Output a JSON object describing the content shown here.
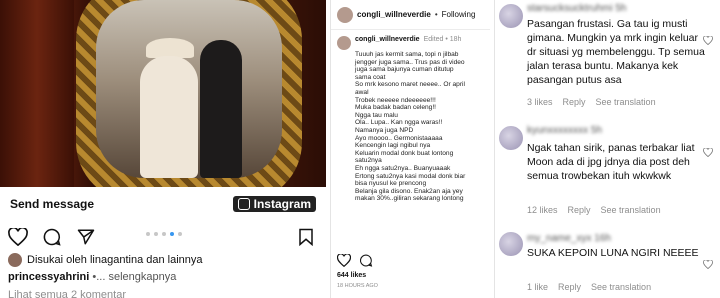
{
  "post_mobile": {
    "send_message": "Send message",
    "instagram_label": "Instagram",
    "liked_by": "Disukai oleh linagantina dan lainnya",
    "caption_user": "princessyahrini",
    "caption_text": " •... selengkapnya",
    "view_all_comments": "Lihat semua 2 komentar",
    "carousel_dots": 5,
    "carousel_active": 3
  },
  "post_desktop": {
    "header_user": "congli_willneverdie",
    "header_sep": "•",
    "header_follow": "Following",
    "caption_user": "congli_willneverdie",
    "caption_meta": "Edited • 18h",
    "caption_lines": [
      "Tuuuh jas kermit sama, topi n jilbab",
      "jengger juga sama.. Trus pas di video",
      "juga sama bajunya cuman ditutup",
      "sama coat",
      "So mrk kesono maret neeee.. Or april",
      "awal",
      "Trobek neeeee ndeeeeee!!!",
      "Muka badak badan celeng!!",
      "Ngga tau malu",
      "Ola.. Lupa.. Kan ngga waras!!",
      "Namanya juga NPD",
      "Ayo moooo.. Germonistaaaaa",
      "Kencengin lagi ngibul nya",
      "Keluarin modal donk buat lontong",
      "satu2nya",
      "Eh ngga satu2nya.. Buanyuaaak",
      "Ertong satu2nya kasi modal donk biar",
      "bisa nyusul ke prencong",
      "Belanja gila disono. Enak2an aja yey",
      "makan 30%..giliran sekarang lontong"
    ],
    "likes": "644 likes",
    "time": "18 HOURS AGO"
  },
  "comments": [
    {
      "user": "starsucksucktruhmi 5h",
      "text": "Pasangan frustasi. Ga tau ig musti gimana. Mungkin ya mrk ingin keluar dr situasi yg membelenggu. Tp semua jalan terasa buntu. Makanya kek pasangan putus asa",
      "likes": "3 likes",
      "reply": "Reply",
      "translation": "See translation"
    },
    {
      "user": "kyunxxxxxxxx 5h",
      "text": "Ngak tahan sirik, panas terbakar liat Moon ada di jpg jdnya dia post deh semua trowbekan ituh wkwkwk",
      "likes": "12 likes",
      "reply": "Reply",
      "translation": "See translation"
    },
    {
      "user": "my_name_xyx 16h",
      "text": "SUKA KEPOIN LUNA NGIRI NEEEE",
      "likes": "1 like",
      "reply": "Reply",
      "translation": "See translation"
    }
  ]
}
